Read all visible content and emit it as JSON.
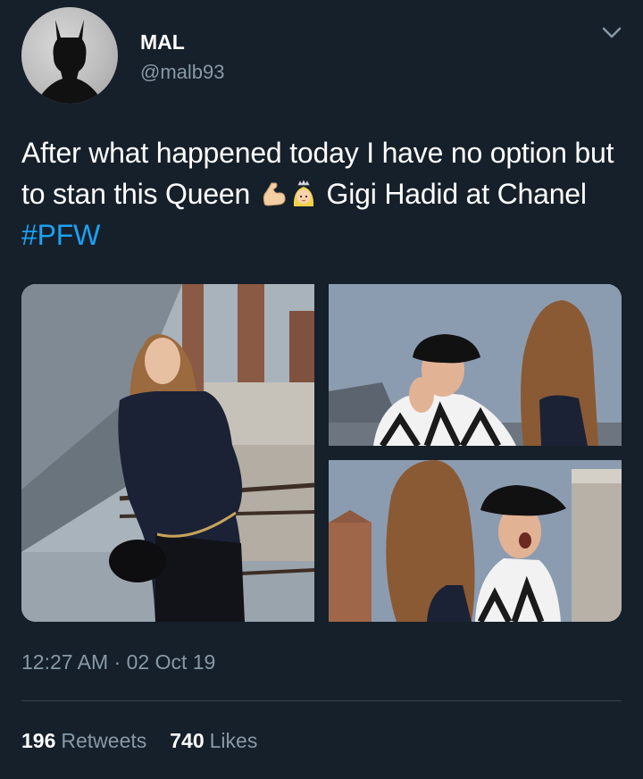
{
  "author": {
    "name": "MAL",
    "handle": "@malb93"
  },
  "tweet": {
    "text_part1": "After what happened today I have no option but to stan this Queen",
    "emoji_1": "flexed-biceps-icon",
    "emoji_2": "princess-icon",
    "text_part2": " Gigi Hadid at Chanel ",
    "hashtag": "#PFW"
  },
  "meta": {
    "timestamp": "12:27 AM · 02 Oct 19"
  },
  "stats": {
    "retweets_count": "196",
    "retweets_label": "Retweets",
    "likes_count": "740",
    "likes_label": "Likes"
  },
  "colors": {
    "background": "#15202b",
    "secondary_text": "#8899a6",
    "accent": "#1da1f2",
    "divider": "#38444d"
  }
}
